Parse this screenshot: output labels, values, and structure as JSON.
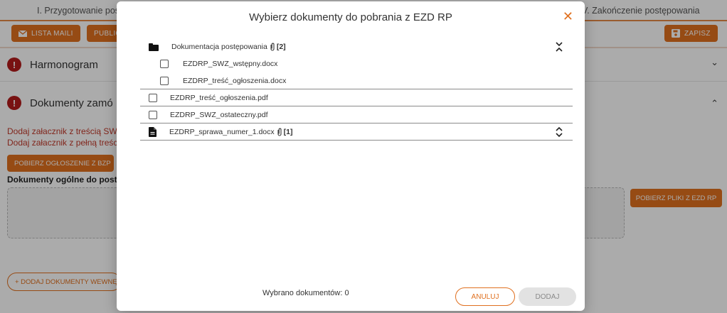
{
  "background": {
    "steps": {
      "first": "I. Przygotowanie post",
      "last": "V. Zakończenie postępowania"
    },
    "toolbar": {
      "lista_maili": "LISTA MAILI",
      "publikuj": "PUBLIC",
      "zapisz": "ZAPISZ"
    },
    "sections": {
      "harmonogram": "Harmonogram",
      "dokumenty": "Dokumenty zamó"
    },
    "warnings": {
      "swz": "Dodaj załacznik z treścią SWZ",
      "ogloszenie": "Dodaj załacznik z pełną treścią"
    },
    "pobierz_ogloszenie_label": "POBIERZ OGŁOSZENIE Z BZP",
    "docs_heading": "Dokumenty ogólne do postę",
    "pobierz_ezd_label": "POBIERZ PLIKI Z EZD RP",
    "dodaj_wew_label": "+ DODAJ DOKUMENTY WEWNĘ"
  },
  "modal": {
    "title": "Wybierz dokumenty do pobrania z EZD RP",
    "folder": {
      "name": "Dokumentacja postępowania",
      "count": "[2]",
      "children": [
        {
          "name": "EZDRP_SWZ_wstępny.docx"
        },
        {
          "name": "EZDRP_treść_ogłoszenia.docx"
        }
      ]
    },
    "files": [
      {
        "name": "EZDRP_treść_ogłoszenia.pdf"
      },
      {
        "name": "EZDRP_SWZ_ostateczny.pdf"
      }
    ],
    "document": {
      "name": "EZDRP_sprawa_numer_1.docx",
      "count": "[1]"
    },
    "selected_count": "Wybrano dokumentów: 0",
    "cancel_label": "ANULUJ",
    "add_label": "DODAJ"
  },
  "colors": {
    "accent": "#e0701f",
    "alert": "#b31b1b"
  }
}
